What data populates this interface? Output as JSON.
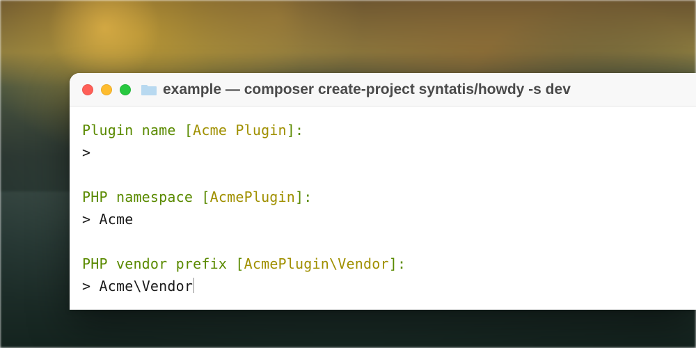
{
  "titlebar": {
    "title": "example — composer create-project syntatis/howdy -s dev"
  },
  "prompts": {
    "p1_label": "Plugin name",
    "p1_default": "Acme Plugin",
    "p1_answer": "",
    "p2_label": "PHP namespace",
    "p2_default": "AcmePlugin",
    "p2_answer": "Acme",
    "p3_label": "PHP vendor prefix",
    "p3_default": "AcmePlugin\\Vendor",
    "p3_answer": "Acme\\Vendor"
  },
  "syntax": {
    "open_bracket": " [",
    "close_bracket_colon": "]:",
    "prompt_arrow": "> "
  }
}
